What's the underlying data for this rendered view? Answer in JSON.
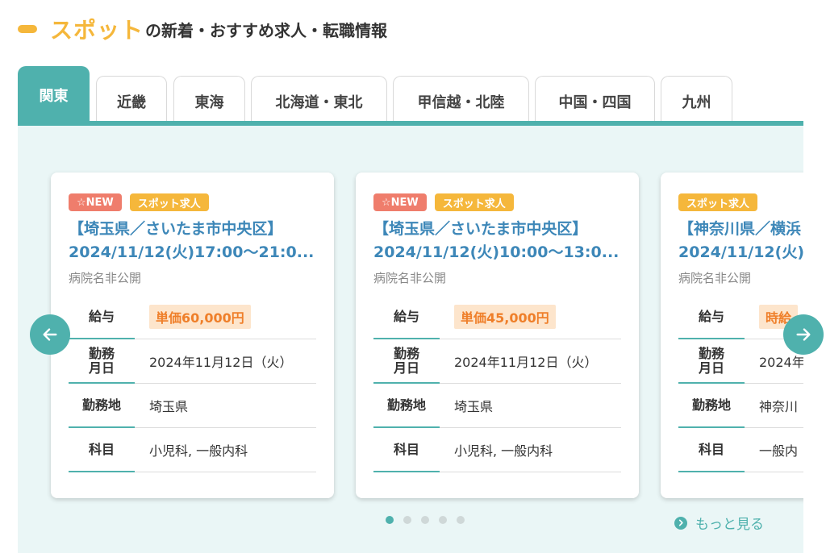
{
  "heading": {
    "accent": "スポット",
    "rest": "の新着・おすすめ求人・転職情報"
  },
  "tabs": [
    "関東",
    "近畿",
    "東海",
    "北海道・東北",
    "甲信越・北陸",
    "中国・四国",
    "九州"
  ],
  "active_tab": "関東",
  "cards": [
    {
      "badge_new": "☆NEW",
      "badge_spot": "スポット求人",
      "title_line1": "【埼玉県／さいたま市中央区】",
      "title_line2": "2024/11/12(火)17:00〜21:0...",
      "hospital": "病院名非公開",
      "pay_label": "給与",
      "pay": "単価60,000円",
      "date_label": "勤務月日",
      "date": "2024年11月12日（火）",
      "place_label": "勤務地",
      "place": "埼玉県",
      "subject_label": "科目",
      "subject": "小児科, 一般内科"
    },
    {
      "badge_new": "☆NEW",
      "badge_spot": "スポット求人",
      "title_line1": "【埼玉県／さいたま市中央区】",
      "title_line2": "2024/11/12(火)10:00〜13:0...",
      "hospital": "病院名非公開",
      "pay_label": "給与",
      "pay": "単価45,000円",
      "date_label": "勤務月日",
      "date": "2024年11月12日（火）",
      "place_label": "勤務地",
      "place": "埼玉県",
      "subject_label": "科目",
      "subject": "小児科, 一般内科"
    },
    {
      "badge_spot": "スポット求人",
      "title_line1": "【神奈川県／横浜",
      "title_line2": "2024/11/12(火)",
      "hospital": "病院名非公開",
      "pay_label": "給与",
      "pay": "時給",
      "date_label": "勤務月日",
      "date": "2024年",
      "place_label": "勤務地",
      "place": "神奈川",
      "subject_label": "科目",
      "subject": "一般内"
    }
  ],
  "carousel": {
    "dot_count": 5,
    "active_dot": 1,
    "prev_icon": "arrow-left-icon",
    "next_icon": "arrow-right-icon"
  },
  "more_label": "もっと見る",
  "colors": {
    "accent": "#f5b73b",
    "teal": "#4fb1ad",
    "link": "#3d87b8",
    "new": "#ef7d6c",
    "pay_bg": "#fde5cc",
    "pay_text": "#ef7f2a",
    "panel_bg": "#eaf6f6"
  }
}
